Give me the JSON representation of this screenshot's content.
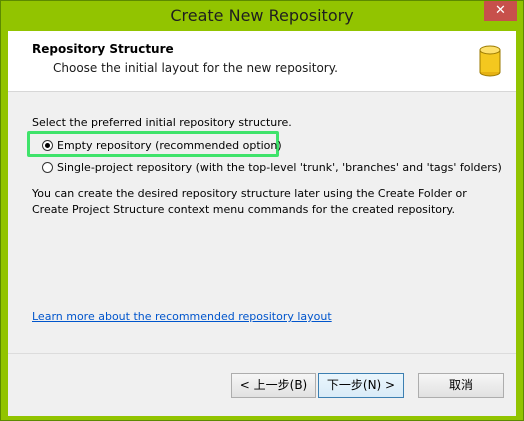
{
  "window": {
    "title": "Create New Repository",
    "close_glyph": "✕"
  },
  "header": {
    "title": "Repository Structure",
    "subtitle": "Choose the initial layout for the new repository.",
    "icon": "database-icon"
  },
  "content": {
    "prompt": "Select the preferred initial repository structure.",
    "options": [
      {
        "label": "Empty repository (recommended option)",
        "checked": true
      },
      {
        "label": "Single-project repository (with the top-level 'trunk', 'branches' and 'tags' folders)",
        "checked": false
      }
    ],
    "info": "You can create the desired repository structure later using the Create Folder or Create Project Structure context menu commands for the created repository.",
    "link": "Learn more about the recommended repository layout"
  },
  "buttons": {
    "back": "< 上一步(B)",
    "next": "下一步(N) >",
    "cancel": "取消"
  },
  "colors": {
    "frame": "#92c400",
    "highlight": "#3fe36b",
    "link": "#0055cc"
  }
}
